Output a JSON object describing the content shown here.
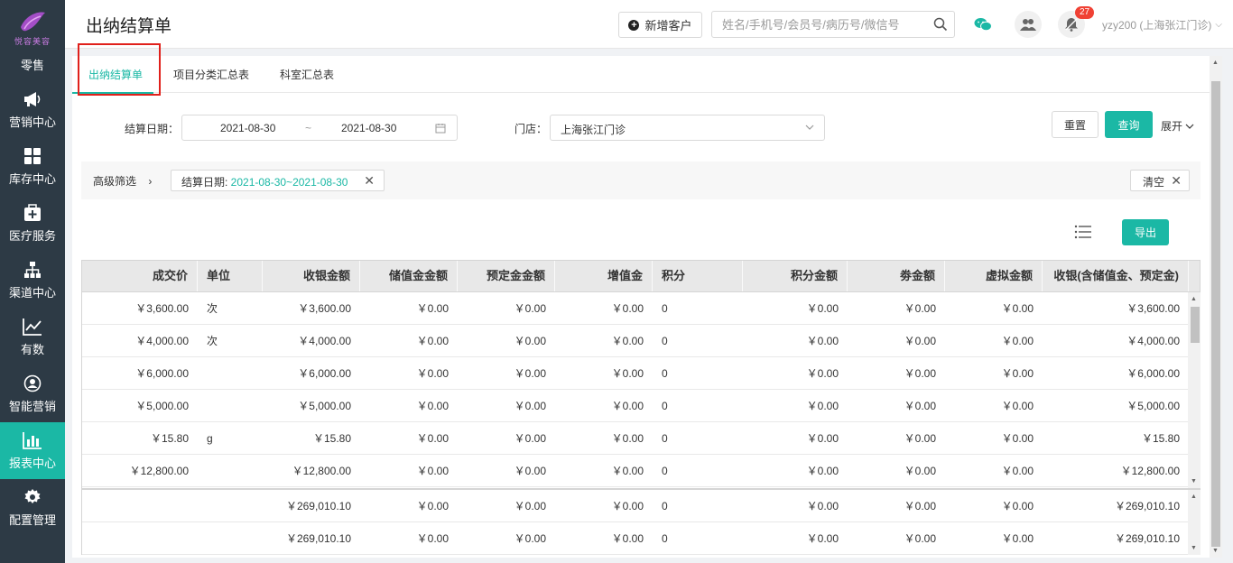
{
  "sidebar": {
    "logo_text": "悦容美容",
    "items": [
      {
        "label": "零售",
        "icon": "retail-icon"
      },
      {
        "label": "营销中心",
        "icon": "megaphone-icon"
      },
      {
        "label": "库存中心",
        "icon": "grid-icon"
      },
      {
        "label": "医疗服务",
        "icon": "medical-kit-icon"
      },
      {
        "label": "渠道中心",
        "icon": "org-chart-icon"
      },
      {
        "label": "有数",
        "icon": "line-chart-icon"
      },
      {
        "label": "智能营销",
        "icon": "smart-marketing-icon"
      },
      {
        "label": "报表中心",
        "icon": "bar-chart-icon",
        "active": true
      },
      {
        "label": "配置管理",
        "icon": "gear-icon"
      }
    ]
  },
  "header": {
    "title": "出纳结算单",
    "new_customer_label": "新增客户",
    "search_placeholder": "姓名/手机号/会员号/病历号/微信号",
    "notification_count": "27",
    "user": "yzy200 (上海张江门诊)"
  },
  "tabs": [
    {
      "label": "出纳结算单",
      "active": true
    },
    {
      "label": "项目分类汇总表"
    },
    {
      "label": "科室汇总表"
    }
  ],
  "filters": {
    "date_label": "结算日期：",
    "date_start": "2021-08-30",
    "date_sep": "~",
    "date_end": "2021-08-30",
    "store_label": "门店：",
    "store_value": "上海张江门诊",
    "reset_label": "重置",
    "query_label": "查询",
    "expand_label": "展开"
  },
  "advanced": {
    "label": "高级筛选",
    "tag_key": "结算日期: ",
    "tag_value": "2021-08-30~2021-08-30",
    "clear_label": "清空"
  },
  "toolbar": {
    "export_label": "导出"
  },
  "table": {
    "columns": [
      "成交价",
      "单位",
      "收银金额",
      "储值金金额",
      "预定金金额",
      "增值金",
      "积分",
      "积分金额",
      "劵金额",
      "虚拟金额",
      "收银(含储值金、预定金)"
    ],
    "rows": [
      [
        "￥3,600.00",
        "次",
        "￥3,600.00",
        "￥0.00",
        "￥0.00",
        "￥0.00",
        "0",
        "￥0.00",
        "￥0.00",
        "￥0.00",
        "￥3,600.00"
      ],
      [
        "￥4,000.00",
        "次",
        "￥4,000.00",
        "￥0.00",
        "￥0.00",
        "￥0.00",
        "0",
        "￥0.00",
        "￥0.00",
        "￥0.00",
        "￥4,000.00"
      ],
      [
        "￥6,000.00",
        "",
        "￥6,000.00",
        "￥0.00",
        "￥0.00",
        "￥0.00",
        "0",
        "￥0.00",
        "￥0.00",
        "￥0.00",
        "￥6,000.00"
      ],
      [
        "￥5,000.00",
        "",
        "￥5,000.00",
        "￥0.00",
        "￥0.00",
        "￥0.00",
        "0",
        "￥0.00",
        "￥0.00",
        "￥0.00",
        "￥5,000.00"
      ],
      [
        "￥15.80",
        "g",
        "￥15.80",
        "￥0.00",
        "￥0.00",
        "￥0.00",
        "0",
        "￥0.00",
        "￥0.00",
        "￥0.00",
        "￥15.80"
      ],
      [
        "￥12,800.00",
        "",
        "￥12,800.00",
        "￥0.00",
        "￥0.00",
        "￥0.00",
        "0",
        "￥0.00",
        "￥0.00",
        "￥0.00",
        "￥12,800.00"
      ]
    ],
    "summary_rows": [
      [
        "",
        "",
        "￥269,010.10",
        "￥0.00",
        "￥0.00",
        "￥0.00",
        "0",
        "￥0.00",
        "￥0.00",
        "￥0.00",
        "￥269,010.10"
      ],
      [
        "",
        "",
        "￥269,010.10",
        "￥0.00",
        "￥0.00",
        "￥0.00",
        "0",
        "￥0.00",
        "￥0.00",
        "￥0.00",
        "￥269,010.10"
      ]
    ]
  },
  "colors": {
    "sidebar_bg": "#2d3a45",
    "accent": "#1bb8a5",
    "highlight_red": "#e0201b"
  }
}
